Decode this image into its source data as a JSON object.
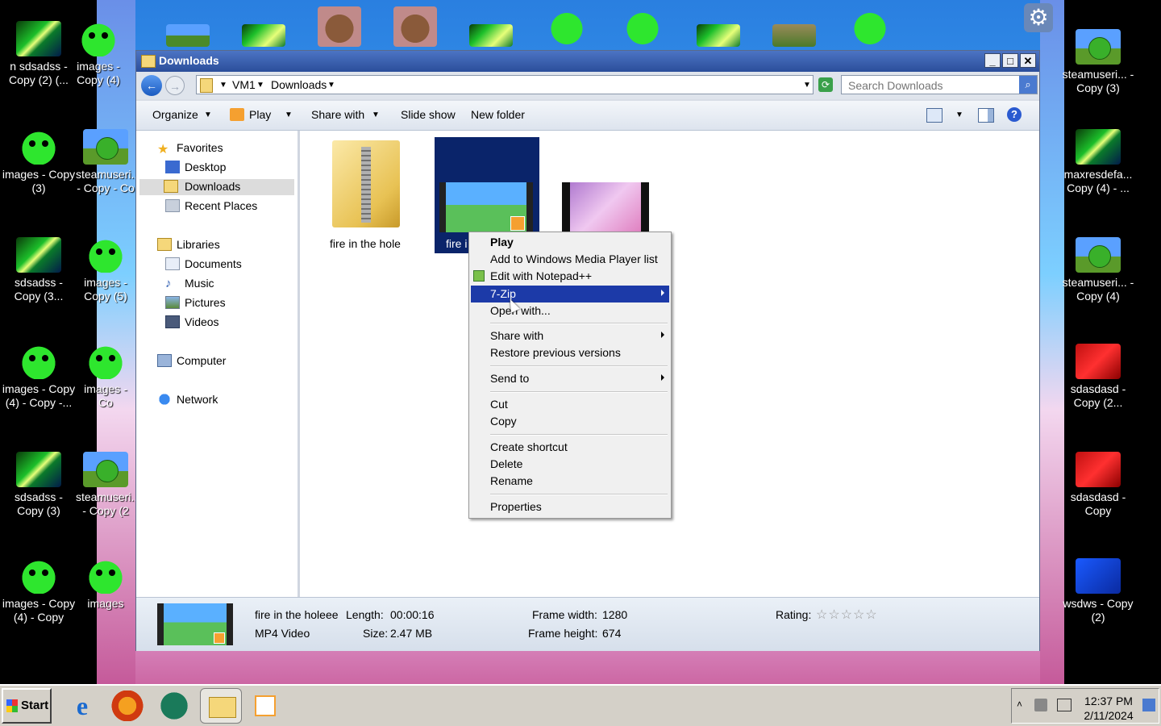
{
  "desktop": {
    "left_icons": [
      {
        "label": "n sdsadss - Copy (2) (...",
        "kind": "laser"
      },
      {
        "label": "images - Copy (4)",
        "kind": "green"
      },
      {
        "label": "images - Copy (3)",
        "kind": "green"
      },
      {
        "label": "steamuseri... - Copy - Co",
        "kind": "steam"
      },
      {
        "label": "sdsadss - Copy (3...",
        "kind": "laser"
      },
      {
        "label": "images - Copy (5)",
        "kind": "green"
      },
      {
        "label": "images - Copy (4) - Copy -...",
        "kind": "green"
      },
      {
        "label": "images - Co",
        "kind": "green"
      },
      {
        "label": "sdsadss - Copy (3)",
        "kind": "laser"
      },
      {
        "label": "steamuseri... - Copy (2",
        "kind": "steam"
      },
      {
        "label": "images - Copy (4) - Copy",
        "kind": "green"
      },
      {
        "label": "images",
        "kind": "green"
      }
    ],
    "right_icons": [
      {
        "label": "steamuseri... - Copy (3)",
        "kind": "steam"
      },
      {
        "label": "maxresdefa... Copy (4) - ...",
        "kind": "laser"
      },
      {
        "label": "steamuseri... - Copy (4)",
        "kind": "steam"
      },
      {
        "label": "sdasdasd - Copy (2...",
        "kind": "red"
      },
      {
        "label": "sdasdasd - Copy",
        "kind": "red"
      },
      {
        "label": "wsdws - Copy (2)",
        "kind": "blue"
      }
    ]
  },
  "window": {
    "title": "Downloads",
    "min": "_",
    "max": "□",
    "close": "✕",
    "breadcrumb": [
      "VM1",
      "Downloads"
    ],
    "search_placeholder": "Search Downloads",
    "toolbar": {
      "organize": "Organize",
      "play": "Play",
      "share_with": "Share with",
      "slide_show": "Slide show",
      "new_folder": "New folder"
    },
    "nav": {
      "favorites": "Favorites",
      "desktop": "Desktop",
      "downloads": "Downloads",
      "recent_places": "Recent Places",
      "libraries": "Libraries",
      "documents": "Documents",
      "music": "Music",
      "pictures": "Pictures",
      "videos": "Videos",
      "computer": "Computer",
      "network": "Network"
    },
    "files": {
      "zip_name": "fire in the hole",
      "video_name": "fire i"
    },
    "details": {
      "name": "fire in the holeee",
      "type": "MP4 Video",
      "length_label": "Length:",
      "length_value": "00:00:16",
      "size_label": "Size:",
      "size_value": "2.47 MB",
      "fw_label": "Frame width:",
      "fw_value": "1280",
      "fh_label": "Frame height:",
      "fh_value": "674",
      "rating_label": "Rating:",
      "rating_stars": "☆☆☆☆☆"
    }
  },
  "context_menu": {
    "play": "Play",
    "add_wmp": "Add to Windows Media Player list",
    "edit_npp": "Edit with Notepad++",
    "seven_zip": "7-Zip",
    "open_with": "Open with...",
    "share_with": "Share with",
    "restore": "Restore previous versions",
    "send_to": "Send to",
    "cut": "Cut",
    "copy": "Copy",
    "create_shortcut": "Create shortcut",
    "delete": "Delete",
    "rename": "Rename",
    "properties": "Properties"
  },
  "taskbar": {
    "start": "Start",
    "time": "12:37 PM",
    "date": "2/11/2024"
  }
}
